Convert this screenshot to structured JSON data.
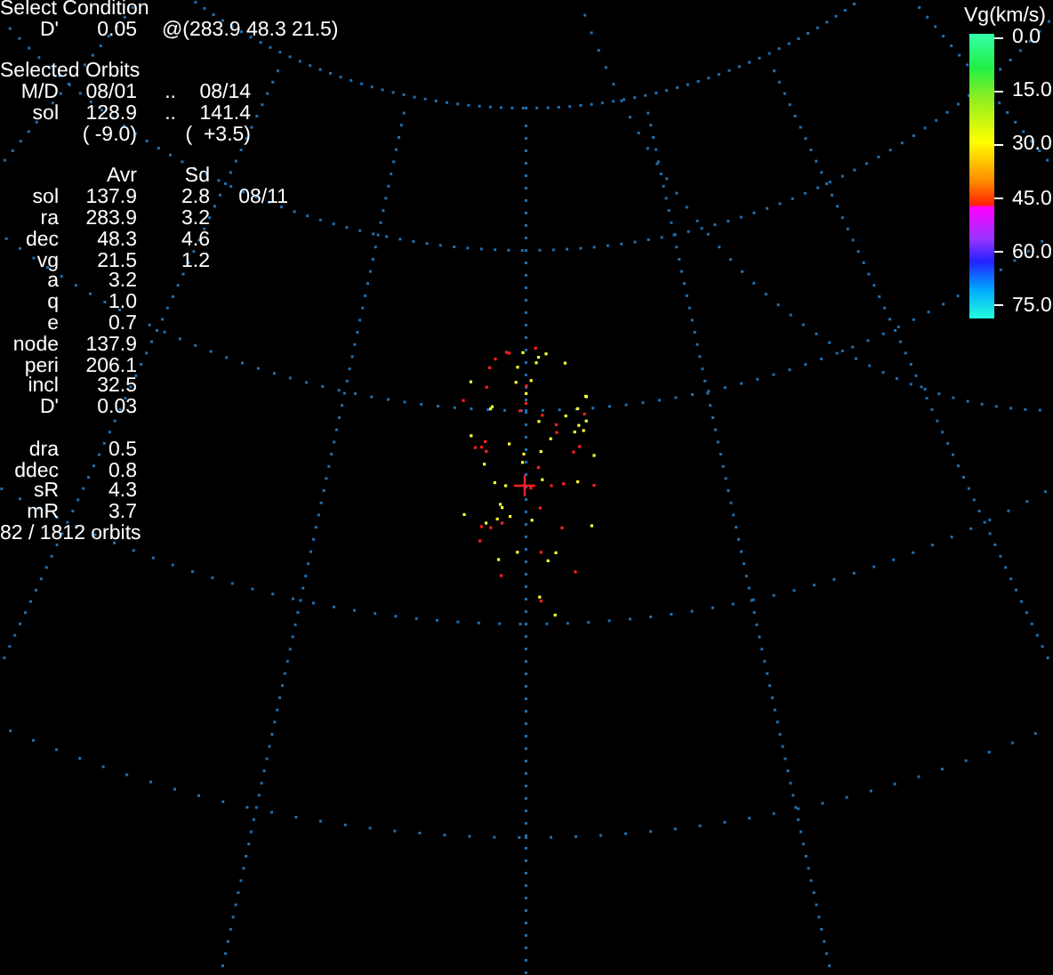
{
  "select_condition": {
    "title": "Select Condition",
    "label": "D'",
    "value": "0.05",
    "center": "@(283.9 48.3 21.5)"
  },
  "selected_orbits": {
    "title": "Selected Orbits",
    "ranges": [
      {
        "label": "M/D",
        "from": "08/01",
        "sep": "..",
        "to": "08/14"
      },
      {
        "label": "sol",
        "from": "128.9",
        "sep": "..",
        "to": "141.4"
      }
    ],
    "offsets": {
      "from": "( -9.0)",
      "to": "(  +3.5)"
    }
  },
  "stats": {
    "columns": [
      "Avr",
      "Sd"
    ],
    "rows": [
      {
        "label": "sol",
        "avr": "137.9",
        "sd": "2.8",
        "note": "08/11"
      },
      {
        "label": "ra",
        "avr": "283.9",
        "sd": "3.2"
      },
      {
        "label": "dec",
        "avr": "48.3",
        "sd": "4.6"
      },
      {
        "label": "vg",
        "avr": "21.5",
        "sd": "1.2"
      },
      {
        "label": "a",
        "avr": "3.2"
      },
      {
        "label": "q",
        "avr": "1.0"
      },
      {
        "label": "e",
        "avr": "0.7"
      },
      {
        "label": "node",
        "avr": "137.9"
      },
      {
        "label": "peri",
        "avr": "206.1"
      },
      {
        "label": "incl",
        "avr": "32.5"
      },
      {
        "label": "D'",
        "avr": "0.03"
      }
    ]
  },
  "spread": [
    {
      "label": "dra",
      "value": "0.5"
    },
    {
      "label": "ddec",
      "value": "0.8"
    },
    {
      "label": "sR",
      "value": "4.3"
    },
    {
      "label": "mR",
      "value": "3.7"
    }
  ],
  "count": "82 / 1812 orbits",
  "legend": {
    "title": "Vg(km/s)",
    "ticks": [
      "0.0",
      "15.0",
      "30.0",
      "45.0",
      "60.0",
      "75.0"
    ]
  }
}
